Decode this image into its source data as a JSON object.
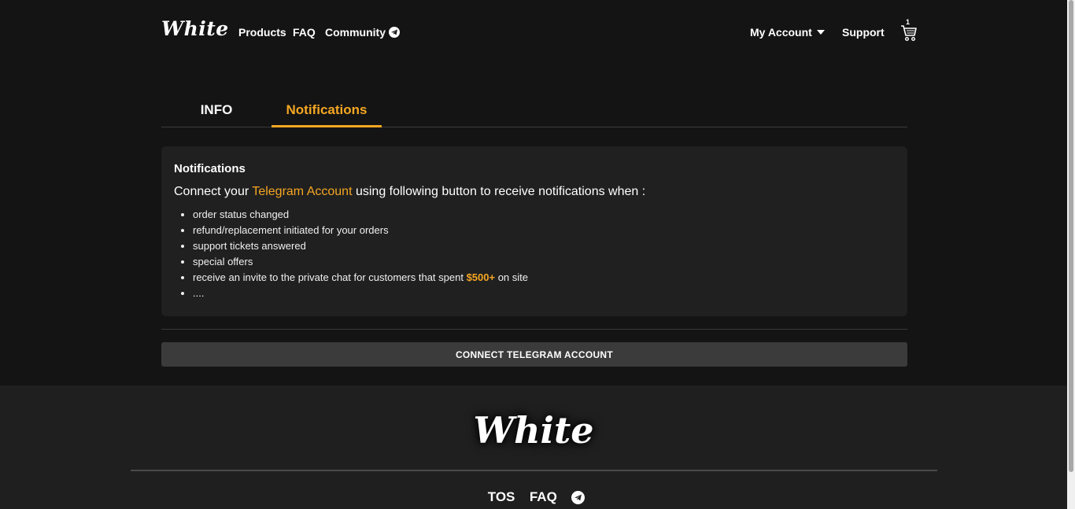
{
  "header": {
    "logo": "White",
    "nav": {
      "products": "Products",
      "faq": "FAQ",
      "community": "Community"
    },
    "my_account": "My Account",
    "support": "Support",
    "cart_count": "1"
  },
  "tabs": {
    "info": "INFO",
    "notifications": "Notifications",
    "active": "Notifications"
  },
  "card": {
    "title": "Notifications",
    "intro_prefix": "Connect your ",
    "intro_link": "Telegram Account",
    "intro_suffix": " using following button to receive notifications when :",
    "items": [
      "order status changed",
      "refund/replacement initiated for your orders",
      "support tickets answered",
      "special offers"
    ],
    "invite_prefix": "receive an invite to the private chat for customers that spent ",
    "invite_amount": "$500+",
    "invite_suffix": " on site",
    "ellipsis": "...."
  },
  "connect_button": "CONNECT TELEGRAM ACCOUNT",
  "footer": {
    "logo": "White",
    "tos": "TOS",
    "faq": "FAQ"
  },
  "colors": {
    "accent": "#f5a623",
    "background": "#141414",
    "card": "#202020",
    "footer": "#1f1f1f"
  },
  "icons": {
    "community": "telegram-icon",
    "cart": "cart-icon",
    "dropdown": "caret-down-icon",
    "footer_social": "telegram-icon"
  }
}
